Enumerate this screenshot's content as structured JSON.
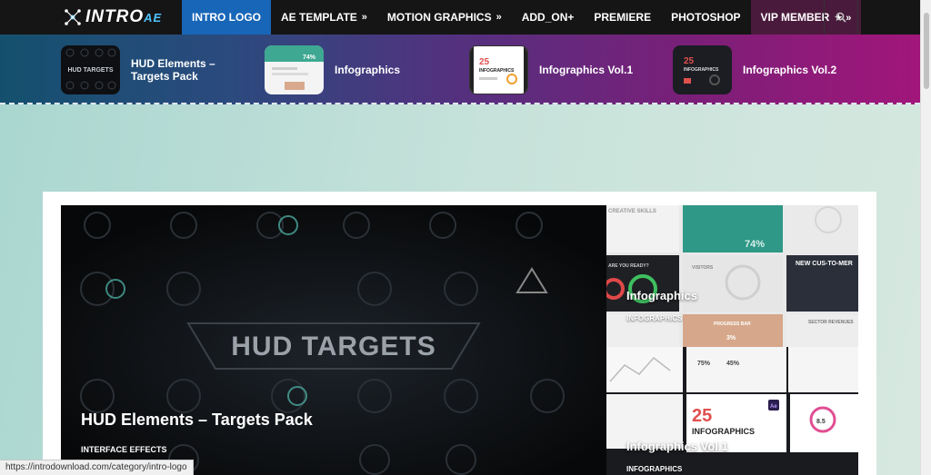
{
  "brand": {
    "logo_main": "INTRO",
    "logo_sub": "AE"
  },
  "nav": {
    "items": [
      {
        "label": "INTRO LOGO",
        "chevron": ""
      },
      {
        "label": "AE TEMPLATE",
        "chevron": "»"
      },
      {
        "label": "MOTION GRAPHICS",
        "chevron": "»"
      },
      {
        "label": "ADD_ON+",
        "chevron": ""
      },
      {
        "label": "PREMIERE",
        "chevron": ""
      },
      {
        "label": "PHOTOSHOP",
        "chevron": ""
      },
      {
        "label": "VIP MEMBER",
        "chevron": "★ »"
      }
    ],
    "search_icon": "search-icon"
  },
  "featured": [
    {
      "title": "HUD Elements – Targets Pack"
    },
    {
      "title": "Infographics"
    },
    {
      "title": "Infographics Vol.1"
    },
    {
      "title": "Infographics Vol.2"
    }
  ],
  "thumb_text": {
    "hud_small": "HUD TARGETS",
    "info_pct": "74%",
    "vol_num": "25",
    "vol_word": "INFOGRAPHICS"
  },
  "main": {
    "hero": {
      "title": "HUD Elements – Targets Pack",
      "category": "INTERFACE EFFECTS",
      "overlay_text": "HUD TARGETS"
    },
    "side1": {
      "title": "Infographics",
      "category": "INFOGRAPHICS",
      "panel_texts": [
        "CREATIVE SKILLS",
        "74%",
        "ARE YOU READY?",
        "VISITORS",
        "NEW CUS-TO-MER",
        "PROGRESS BAR",
        "3%",
        "SECTOR REVENUES",
        "75%",
        "45%"
      ]
    },
    "side2": {
      "title": "Infographics Vol.1",
      "category": "INFOGRAPHICS",
      "num": "25",
      "word": "INFOGRAPHICS",
      "value": "8.5",
      "badge": "Ae"
    }
  },
  "status_bar": {
    "url": "https://introdownload.com/category/intro-logo"
  }
}
